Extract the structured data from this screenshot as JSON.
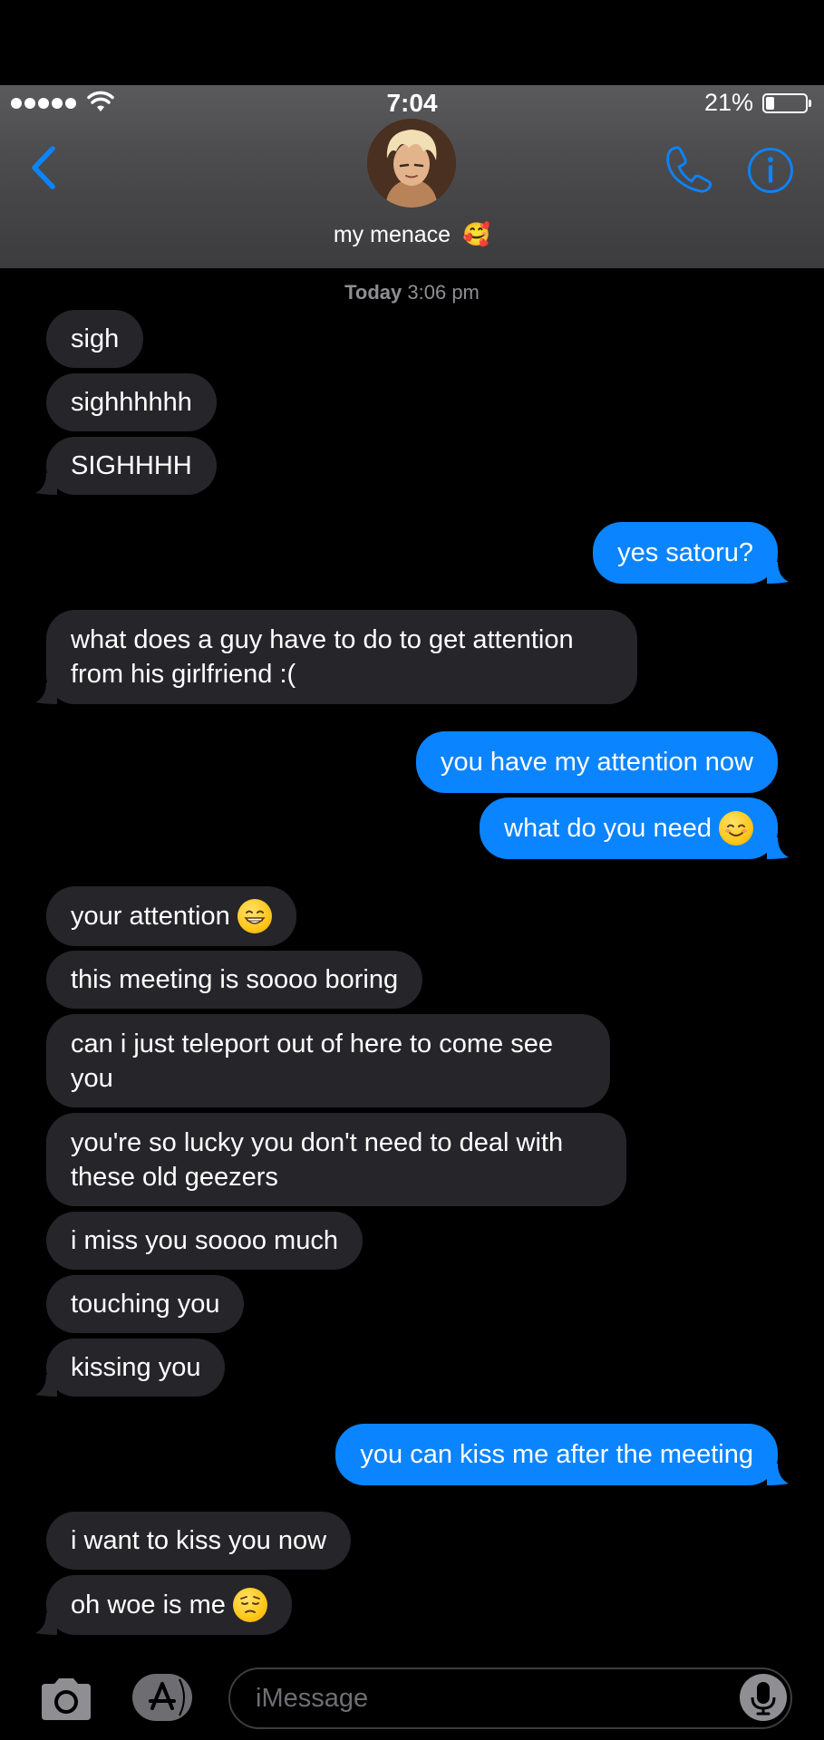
{
  "status_bar": {
    "time": "7:04",
    "battery_text": "21%",
    "battery_level": 0.21
  },
  "header": {
    "contact_name": "my menace",
    "contact_emoji": "🥰"
  },
  "timestamp": {
    "day": "Today",
    "time": "3:06 pm"
  },
  "messages": [
    {
      "side": "in",
      "text": "sigh"
    },
    {
      "side": "in",
      "text": "sighhhhhh"
    },
    {
      "side": "in",
      "text": "SIGHHHH"
    },
    {
      "side": "out",
      "text": "yes satoru?"
    },
    {
      "side": "in",
      "text": "what does a guy have to do to get attention from his girlfriend :("
    },
    {
      "side": "out",
      "text": "you have my attention now"
    },
    {
      "side": "out",
      "text": "what do you need",
      "emoji": "☺️"
    },
    {
      "side": "in",
      "text": "your attention",
      "emoji": "😁"
    },
    {
      "side": "in",
      "text": "this meeting is soooo boring"
    },
    {
      "side": "in",
      "text": "can i just teleport out of here to come see you"
    },
    {
      "side": "in",
      "text": "you're so lucky you don't need to deal with these old geezers"
    },
    {
      "side": "in",
      "text": "i miss you soooo much"
    },
    {
      "side": "in",
      "text": "touching you"
    },
    {
      "side": "in",
      "text": "kissing you"
    },
    {
      "side": "out",
      "text": "you can kiss me after the meeting"
    },
    {
      "side": "in",
      "text": "i want to kiss you now"
    },
    {
      "side": "in",
      "text": "oh woe is me",
      "emoji": "😔"
    }
  ],
  "input": {
    "placeholder": "iMessage"
  },
  "colors": {
    "incoming_bubble": "#26252a",
    "outgoing_bubble": "#0b84ff",
    "accent": "#0b84ff"
  },
  "icons": {
    "back": "chevron-left-icon",
    "phone": "phone-icon",
    "info": "info-icon",
    "camera": "camera-icon",
    "apps": "app-store-icon",
    "mic": "microphone-icon"
  }
}
